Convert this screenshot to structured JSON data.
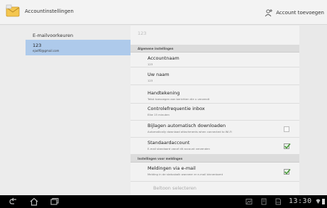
{
  "header": {
    "title": "Accountinstellingen",
    "add_account_label": "Account toevoegen"
  },
  "left": {
    "items": [
      {
        "label": "E-mailvoorkeuren"
      },
      {
        "name": "123",
        "email": "ejadf0@gmail.com"
      }
    ]
  },
  "right": {
    "title": "123",
    "sections": [
      {
        "header": "Algemene instellingen"
      },
      {
        "header": "Instellingen voor meldingen"
      }
    ],
    "prefs": [
      {
        "title": "Accountnaam",
        "summary": "123"
      },
      {
        "title": "Uw naam",
        "summary": "123"
      },
      {
        "title": "Handtekening",
        "summary": "Tekst toevoegen aan berichten die u verzendt"
      },
      {
        "title": "Controlefrequentie inbox",
        "summary": "Elke 15 minuten"
      },
      {
        "title": "Bijlagen automatisch downloaden",
        "summary": "Automatically download attachments when connected to Wi-Fi",
        "checked": false
      },
      {
        "title": "Standaardaccount",
        "summary": "E-mail standaard vanaf dit account verzenden",
        "checked": true
      },
      {
        "title": "Meldingen via e-mail",
        "summary": "Melding in de statusbalk wanneer er e-mail binnenkomt",
        "checked": true
      }
    ],
    "ringtone_title": "Beltoon selecteren"
  },
  "navbar": {
    "clock": "13:30"
  },
  "colors": {
    "selected_bg": "#aecaeb",
    "check_green": "#4a9a3a"
  }
}
